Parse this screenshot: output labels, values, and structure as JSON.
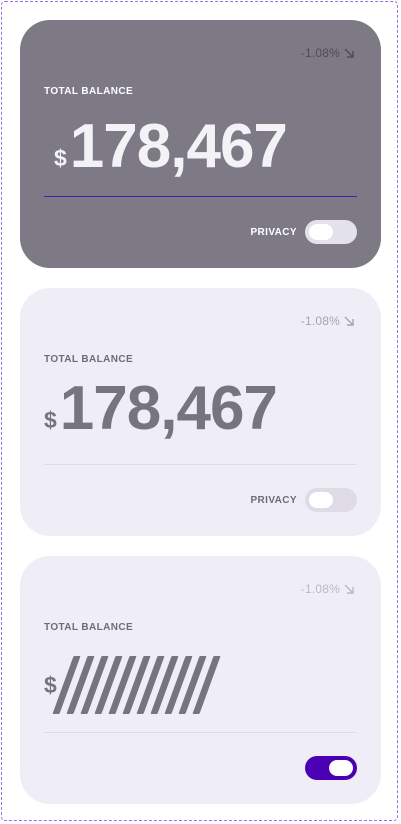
{
  "cards": [
    {
      "change": "-1.08%",
      "label": "TOTAL BALANCE",
      "currency": "$",
      "amount": "178,467",
      "privacy_label": "PRIVACY",
      "privacy_on": false
    },
    {
      "change": "-1.08%",
      "label": "TOTAL BALANCE",
      "currency": "$",
      "amount": "178,467",
      "privacy_label": "PRIVACY",
      "privacy_on": false
    },
    {
      "change": "-1.08%",
      "label": "TOTAL BALANCE",
      "currency": "$",
      "amount_masked": "///////////",
      "privacy_on": true
    }
  ],
  "icons": {
    "change_arrow": "arrow-down-right-icon"
  },
  "colors": {
    "accent": "#4a00b4",
    "dark_card": "#7d7a86",
    "light_card": "#efedf6"
  }
}
